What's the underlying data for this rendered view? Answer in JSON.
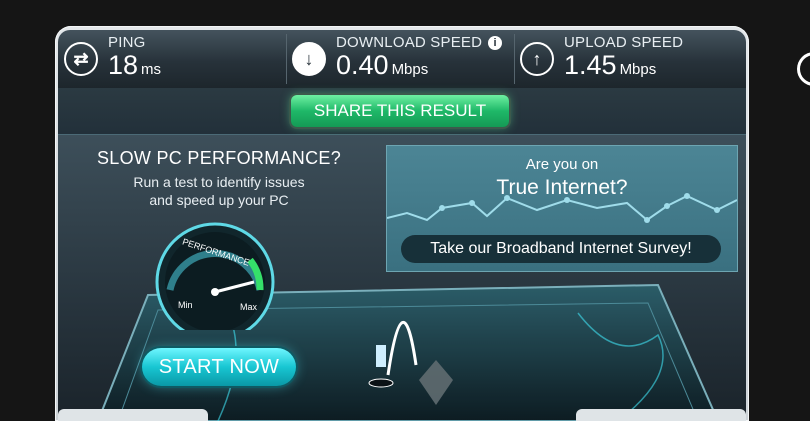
{
  "metrics": {
    "ping": {
      "label": "PING",
      "value": "18",
      "unit": "ms",
      "icon": "exchange-arrows-icon"
    },
    "download": {
      "label": "DOWNLOAD SPEED",
      "value": "0.40",
      "unit": "Mbps",
      "icon": "download-arrow-icon",
      "info_icon": "i"
    },
    "upload": {
      "label": "UPLOAD SPEED",
      "value": "1.45",
      "unit": "Mbps",
      "icon": "upload-arrow-icon"
    }
  },
  "share": {
    "label": "SHARE THIS RESULT"
  },
  "pc_ad": {
    "title": "SLOW PC PERFORMANCE?",
    "line1": "Run a test to identify issues",
    "line2": "and speed up your PC",
    "gauge_label": "PERFORMANCE",
    "gauge_min": "Min",
    "gauge_max": "Max",
    "button": "START NOW"
  },
  "survey_ad": {
    "small": "Are you on",
    "big": "True Internet?",
    "button": "Take our Broadband Internet Survey!"
  },
  "colors": {
    "share_green": "#1fb868",
    "start_cyan": "#18c6d2",
    "panel_dark": "#27323a"
  }
}
